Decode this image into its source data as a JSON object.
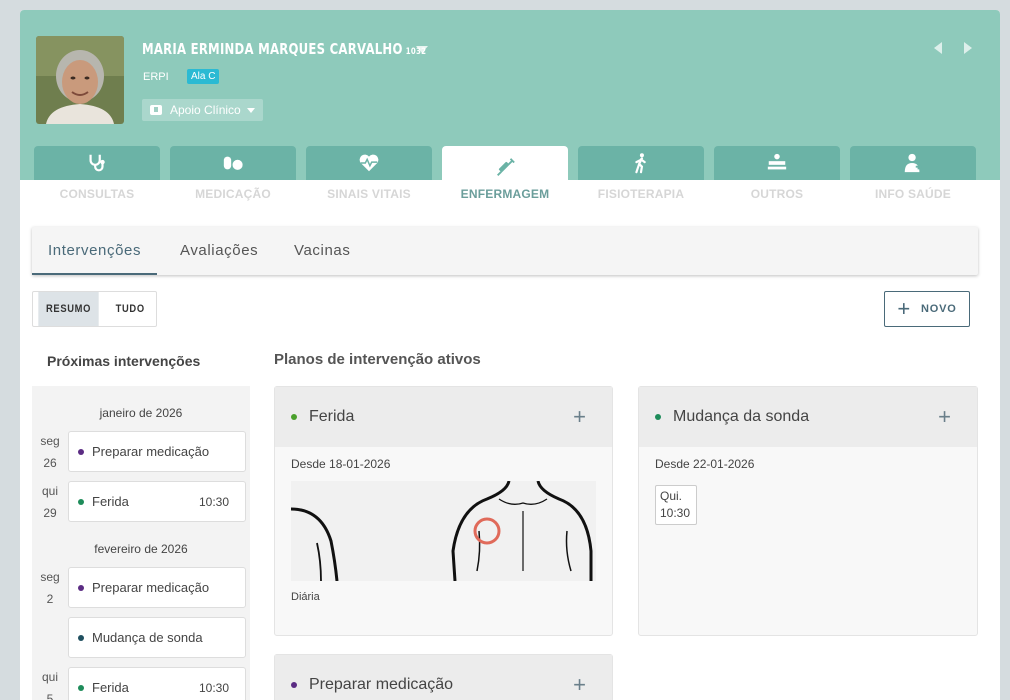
{
  "patient": {
    "name": "MARIA ERMINDA MARQUES CARVALHO",
    "number": "1032",
    "type": "ERPI",
    "wing": "Ala C",
    "support_label": "Apoio Clínico"
  },
  "tabs": [
    {
      "label": "CONSULTAS",
      "icon": "stethoscope-icon"
    },
    {
      "label": "MEDICAÇÃO",
      "icon": "pills-icon"
    },
    {
      "label": "SINAIS VITAIS",
      "icon": "heartbeat-icon"
    },
    {
      "label": "ENFERMAGEM",
      "icon": "syringe-icon",
      "active": true
    },
    {
      "label": "FISIOTERAPIA",
      "icon": "walking-icon"
    },
    {
      "label": "OUTROS",
      "icon": "bed-icon"
    },
    {
      "label": "INFO SAÚDE",
      "icon": "user-medical-icon"
    }
  ],
  "subtabs": [
    "Intervenções",
    "Avaliações",
    "Vacinas"
  ],
  "toggle": {
    "resumo": "RESUMO",
    "tudo": "TUDO"
  },
  "new_button": "NOVO",
  "sidebar": {
    "title": "Próximas intervenções",
    "months": [
      {
        "label": "janeiro de 2026",
        "days": [
          {
            "weekday": "seg",
            "day": "26",
            "events": [
              {
                "name": "Preparar medicação",
                "color": "#5b2c83",
                "time": ""
              }
            ]
          },
          {
            "weekday": "qui",
            "day": "29",
            "events": [
              {
                "name": "Ferida",
                "color": "#1e8c5a",
                "time": "10:30"
              }
            ]
          }
        ]
      },
      {
        "label": "fevereiro de 2026",
        "days": [
          {
            "weekday": "seg",
            "day": "2",
            "events": [
              {
                "name": "Preparar medicação",
                "color": "#5b2c83",
                "time": ""
              },
              {
                "name": "Mudança de sonda",
                "color": "#1f4f5f",
                "time": ""
              }
            ]
          },
          {
            "weekday": "qui",
            "day": "5",
            "events": [
              {
                "name": "Ferida",
                "color": "#1e8c5a",
                "time": "10:30"
              }
            ]
          }
        ]
      }
    ]
  },
  "main": {
    "title": "Planos de intervenção ativos",
    "plans": [
      {
        "name": "Ferida",
        "color": "#4aa02c",
        "since": "Desde 18-01-2026",
        "frequency": "Diária"
      },
      {
        "name": "Mudança da sonda",
        "color": "#1e8c5a",
        "since": "Desde 22-01-2026",
        "slot_day": "Qui.",
        "slot_time": "10:30"
      },
      {
        "name": "Preparar medicação",
        "color": "#5b2c83"
      }
    ]
  },
  "colors": {
    "header": "#8ecabb",
    "tab": "#6bb3a6",
    "accent": "#4a6a79"
  }
}
